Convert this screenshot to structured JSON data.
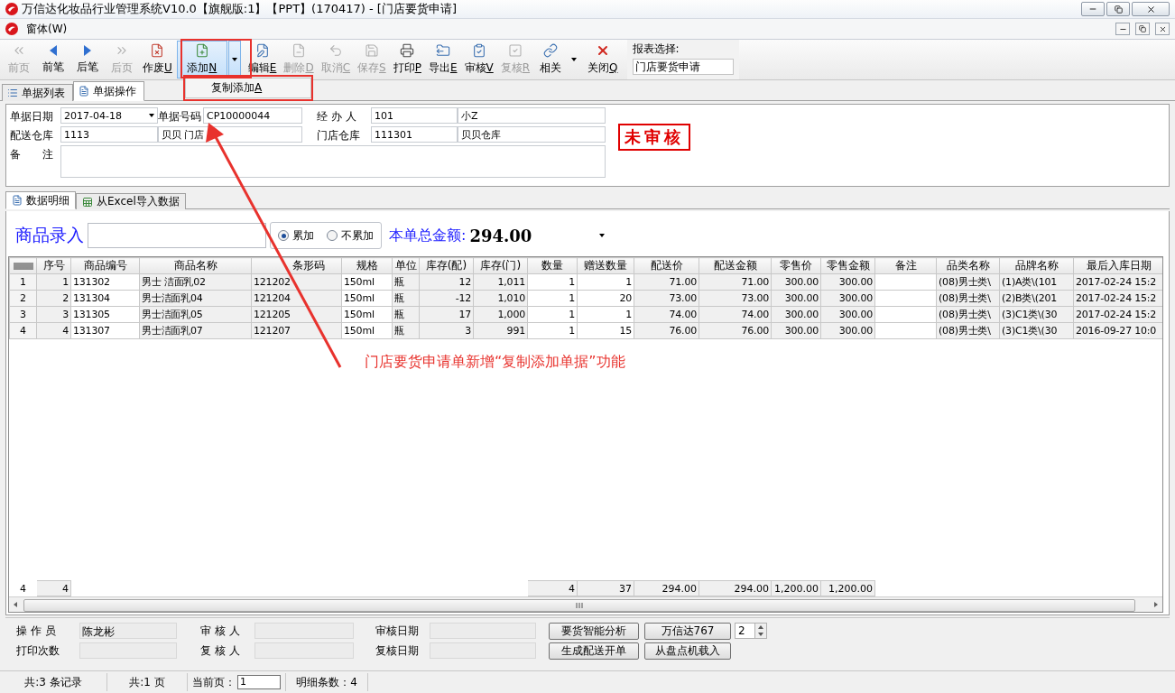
{
  "window": {
    "title": "万信达化妆品行业管理系统V10.0【旗舰版:1】【PPT】(170417) - [门店要货申请]"
  },
  "menu": {
    "items": [
      {
        "label": "窗体(W)"
      }
    ]
  },
  "toolbar": {
    "buttons": [
      {
        "label": "前页",
        "disabled": true,
        "pressed": false,
        "dropdown": false
      },
      {
        "label": "前笔",
        "disabled": false,
        "pressed": false,
        "dropdown": false
      },
      {
        "label": "后笔",
        "disabled": false,
        "pressed": false,
        "dropdown": false
      },
      {
        "label": "后页",
        "disabled": true,
        "pressed": false,
        "dropdown": false
      },
      {
        "label": "作废",
        "accel": "U",
        "disabled": false,
        "pressed": false,
        "dropdown": false
      },
      {
        "label": "添加",
        "accel": "N",
        "disabled": false,
        "pressed": true,
        "dropdown": true
      },
      {
        "label": "编辑",
        "accel": "E",
        "disabled": false,
        "pressed": false,
        "dropdown": false
      },
      {
        "label": "删除",
        "accel": "D",
        "disabled": true,
        "pressed": false,
        "dropdown": false
      },
      {
        "label": "取消",
        "accel": "C",
        "disabled": true,
        "pressed": false,
        "dropdown": false
      },
      {
        "label": "保存",
        "accel": "S",
        "disabled": true,
        "pressed": false,
        "dropdown": false
      },
      {
        "label": "打印",
        "accel": "P",
        "disabled": false,
        "pressed": false,
        "dropdown": false
      },
      {
        "label": "导出",
        "accel": "E",
        "disabled": false,
        "pressed": false,
        "dropdown": false
      },
      {
        "label": "审核",
        "accel": "V",
        "disabled": false,
        "pressed": false,
        "dropdown": false
      },
      {
        "label": "复核",
        "accel": "R",
        "disabled": true,
        "pressed": false,
        "dropdown": false
      },
      {
        "label": "相关",
        "disabled": false,
        "pressed": false,
        "dropdown": true
      },
      {
        "label": "关闭",
        "accel": "Q",
        "disabled": false,
        "pressed": false,
        "dropdown": false
      }
    ],
    "report_select": {
      "label": "报表选择:",
      "value": "门店要货申请"
    }
  },
  "dropdown_menu": {
    "items": [
      {
        "label": "复制添加",
        "accel": "A"
      }
    ]
  },
  "tabs": [
    {
      "label": "单据列表",
      "selected": false
    },
    {
      "label": "单据操作",
      "selected": true
    }
  ],
  "form": {
    "date_label": "单据日期",
    "date": "2017-04-18",
    "number_label": "单据号码",
    "number": "CP10000044",
    "handler_label": "经 办 人",
    "handler_code": "101",
    "handler_name": "小Z",
    "ship_label": "配送仓库",
    "ship_code": "1113",
    "ship_name": "贝贝 门店",
    "store_label": "门店仓库",
    "store_code": "111301",
    "store_name": "贝贝仓库",
    "note_label": "备　　注"
  },
  "stamp": "未审核",
  "detail_tabs": [
    {
      "label": "数据明细",
      "selected": true
    },
    {
      "label": "从Excel导入数据",
      "selected": false
    }
  ],
  "entry": {
    "label": "商品录入",
    "modes": [
      {
        "label": "累加",
        "selected": true
      },
      {
        "label": "不累加",
        "selected": false
      }
    ],
    "total_label": "本单总金额:",
    "total": "294.00"
  },
  "grid": {
    "columns": [
      {
        "label": "序号",
        "kind": "number",
        "readonly": true,
        "total": "4"
      },
      {
        "label": "商品编号",
        "kind": "text",
        "readonly": false
      },
      {
        "label": "商品名称",
        "kind": "text",
        "readonly": true
      },
      {
        "label": "条形码",
        "kind": "text",
        "readonly": true
      },
      {
        "label": "规格",
        "kind": "text",
        "readonly": false
      },
      {
        "label": "单位",
        "kind": "text",
        "readonly": true
      },
      {
        "label": "库存(配)",
        "kind": "number",
        "readonly": true
      },
      {
        "label": "库存(门)",
        "kind": "number",
        "readonly": true
      },
      {
        "label": "数量",
        "kind": "number",
        "readonly": false,
        "total": "4"
      },
      {
        "label": "赠送数量",
        "kind": "number",
        "readonly": false,
        "total": "37"
      },
      {
        "label": "配送价",
        "kind": "number",
        "readonly": true,
        "total": "294.00"
      },
      {
        "label": "配送金额",
        "kind": "number",
        "readonly": true,
        "total": "294.00"
      },
      {
        "label": "零售价",
        "kind": "number",
        "readonly": true,
        "total": "1,200.00"
      },
      {
        "label": "零售金额",
        "kind": "number",
        "readonly": true,
        "total": "1,200.00"
      },
      {
        "label": "备注",
        "kind": "text",
        "readonly": false
      },
      {
        "label": "品类名称",
        "kind": "text",
        "readonly": true
      },
      {
        "label": "品牌名称",
        "kind": "text",
        "readonly": true
      },
      {
        "label": "最后入库日期",
        "kind": "text",
        "readonly": true
      }
    ],
    "rows": [
      {
        "header": "1",
        "cells": [
          "1",
          "131302",
          "男士 洁面乳02",
          "121202",
          "150ml",
          "瓶",
          "12",
          "1,011",
          "1",
          "1",
          "71.00",
          "71.00",
          "300.00",
          "300.00",
          null,
          "(08)男士类\\",
          "(1)A类\\(101",
          "2017-02-24 15:2"
        ]
      },
      {
        "header": "2",
        "cells": [
          "2",
          "131304",
          "男士洁面乳04",
          "121204",
          "150ml",
          "瓶",
          "-12",
          "1,010",
          "1",
          "20",
          "73.00",
          "73.00",
          "300.00",
          "300.00",
          null,
          "(08)男士类\\",
          "(2)B类\\(201",
          "2017-02-24 15:2"
        ]
      },
      {
        "header": "3",
        "cells": [
          "3",
          "131305",
          "男士洁面乳05",
          "121205",
          "150ml",
          "瓶",
          "17",
          "1,000",
          "1",
          "1",
          "74.00",
          "74.00",
          "300.00",
          "300.00",
          null,
          "(08)男士类\\",
          "(3)C1类\\(30",
          "2017-02-24 15:2"
        ]
      },
      {
        "header": "4",
        "cells": [
          "4",
          "131307",
          "男士洁面乳07",
          "121207",
          "150ml",
          "瓶",
          "3",
          "991",
          "1",
          "15",
          "76.00",
          "76.00",
          "300.00",
          "300.00",
          null,
          "(08)男士类\\",
          "(3)C1类\\(30",
          "2016-09-27 10:0"
        ]
      }
    ],
    "summary_label": "4"
  },
  "audit": {
    "operator_label": "操 作 员",
    "operator": "陈龙彬",
    "auditor_label": "审 核 人",
    "audit_date_label": "审核日期",
    "print_count_label": "打印次数",
    "reviewer_label": "复 核 人",
    "review_date_label": "复核日期"
  },
  "actions": [
    {
      "label": "要货智能分析"
    },
    {
      "label": "万信达767"
    },
    {
      "label": "生成配送开单"
    },
    {
      "label": "从盘点机载入"
    }
  ],
  "spinner": "2",
  "status_bar": {
    "records": "共:3 条记录",
    "pages": "共:1 页",
    "page_label": "当前页：",
    "page": "1",
    "detail_count": "明细条数：4"
  },
  "annotation": {
    "text": "门店要货申请单新增“复制添加单据”功能"
  }
}
